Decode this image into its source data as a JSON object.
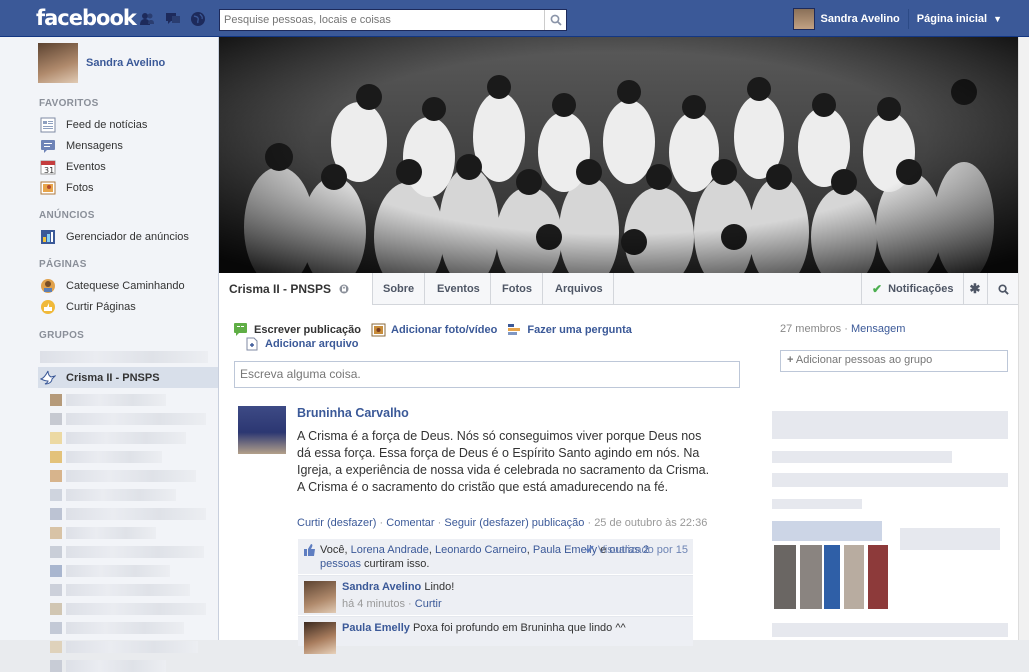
{
  "topbar": {
    "logo": "facebook",
    "search_placeholder": "Pesquise pessoas, locais e coisas",
    "user_name": "Sandra Avelino",
    "home_label": "Página inicial"
  },
  "left": {
    "profile_name": "Sandra Avelino",
    "favorites_heading": "FAVORITOS",
    "favorites": [
      {
        "label": "Feed de notícias",
        "icon": "news-feed-icon"
      },
      {
        "label": "Mensagens",
        "icon": "messages-icon"
      },
      {
        "label": "Eventos",
        "icon": "events-icon"
      },
      {
        "label": "Fotos",
        "icon": "photos-icon"
      }
    ],
    "ads_heading": "ANÚNCIOS",
    "ads": [
      {
        "label": "Gerenciador de anúncios",
        "icon": "ads-manager-icon"
      }
    ],
    "pages_heading": "PÁGINAS",
    "pages": [
      {
        "label": "Catequese Caminhando",
        "icon": "page-icon"
      },
      {
        "label": "Curtir Páginas",
        "icon": "like-pages-icon"
      }
    ],
    "groups_heading": "GRUPOS",
    "selected_group": "Crisma II - PNSPS"
  },
  "group": {
    "name": "Crisma II - PNSPS",
    "tabs": [
      "Sobre",
      "Eventos",
      "Fotos",
      "Arquivos"
    ],
    "notifications_label": "Notificações"
  },
  "composer": {
    "write_post": "Escrever publicação",
    "add_photo": "Adicionar foto/vídeo",
    "ask_question": "Fazer uma pergunta",
    "add_file": "Adicionar arquivo",
    "placeholder": "Escreva alguma coisa."
  },
  "post": {
    "author": "Bruninha Carvalho",
    "text": "A Crisma é a força de Deus. Nós só conseguimos viver porque Deus nos dá essa força. Essa força de Deus é o Espírito Santo agindo em nós. Na Igreja, a experiência de nossa vida é celebrada no sacramento da Crisma. A Crisma é o sacramento do cristão que está amadurecendo na fé.",
    "like_link": "Curtir (desfazer)",
    "comment_link": "Comentar",
    "follow_link": "Seguir (desfazer) publicação",
    "date": "25 de outubro às 22:36",
    "likes_you": "Você,",
    "likes_people": [
      "Lorena Andrade",
      "Leonardo Carneiro",
      "Paula Emelly"
    ],
    "likes_and": "e",
    "likes_others": "outras 2 pessoas",
    "likes_suffix": "curtiram isso.",
    "seen_by": "Visualizado por 15",
    "comments": [
      {
        "name": "Sandra Avelino",
        "text": "Lindo!",
        "time": "há 4 minutos",
        "action": "Curtir"
      },
      {
        "name": "Paula Emelly",
        "text": "Poxa foi profundo em Bruninha que lindo ^^"
      }
    ]
  },
  "right": {
    "members": "27 membros",
    "message_link": "Mensagem",
    "add_people_placeholder": "Adicionar pessoas ao grupo"
  },
  "colors": {
    "brand": "#3b5998",
    "link": "#3b5998",
    "meta_link": "#6d84b4",
    "sidebar_bg": "#f2f4f8"
  }
}
